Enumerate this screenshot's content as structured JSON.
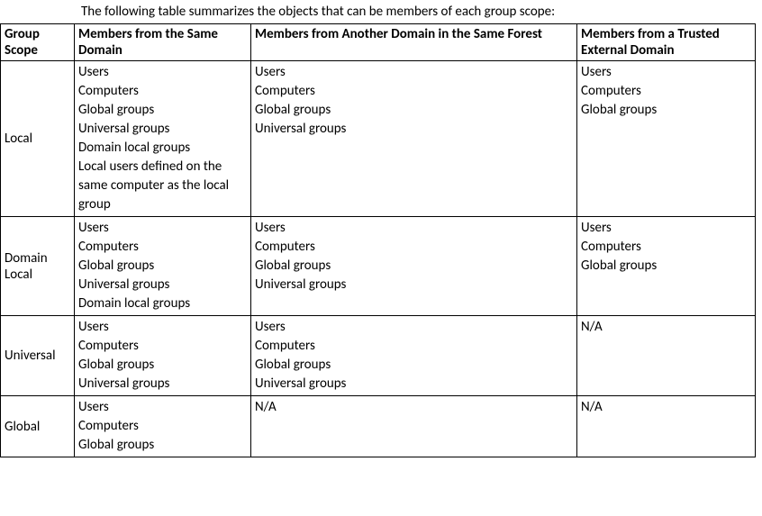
{
  "intro": "The following table summarizes the objects that can be members of each group scope:",
  "headers": {
    "c1": "Group Scope",
    "c2": "Members from the Same Domain",
    "c3": "Members from Another Domain in the Same Forest",
    "c4": "Members from a Trusted External Domain"
  },
  "rows": [
    {
      "scope": "Local",
      "same": [
        "Users",
        "Computers",
        "Global groups",
        "Universal groups",
        "Domain local groups",
        "Local users defined on the same computer as the local group"
      ],
      "forest": [
        "Users",
        "Computers",
        "Global groups",
        "Universal groups"
      ],
      "trusted": [
        "Users",
        "Computers",
        "Global groups"
      ]
    },
    {
      "scope": "Domain Local",
      "same": [
        "Users",
        "Computers",
        "Global groups",
        "Universal groups",
        "Domain local groups"
      ],
      "forest": [
        "Users",
        "Computers",
        "Global groups",
        "Universal groups"
      ],
      "trusted": [
        "Users",
        "Computers",
        "Global groups"
      ]
    },
    {
      "scope": "Universal",
      "same": [
        "Users",
        "Computers",
        "Global groups",
        "Universal groups"
      ],
      "forest": [
        "Users",
        "Computers",
        "Global groups",
        "Universal groups"
      ],
      "trusted": [
        "N/A"
      ]
    },
    {
      "scope": "Global",
      "same": [
        "Users",
        "Computers",
        "Global groups"
      ],
      "forest": [
        "N/A"
      ],
      "trusted": [
        "N/A"
      ]
    }
  ]
}
